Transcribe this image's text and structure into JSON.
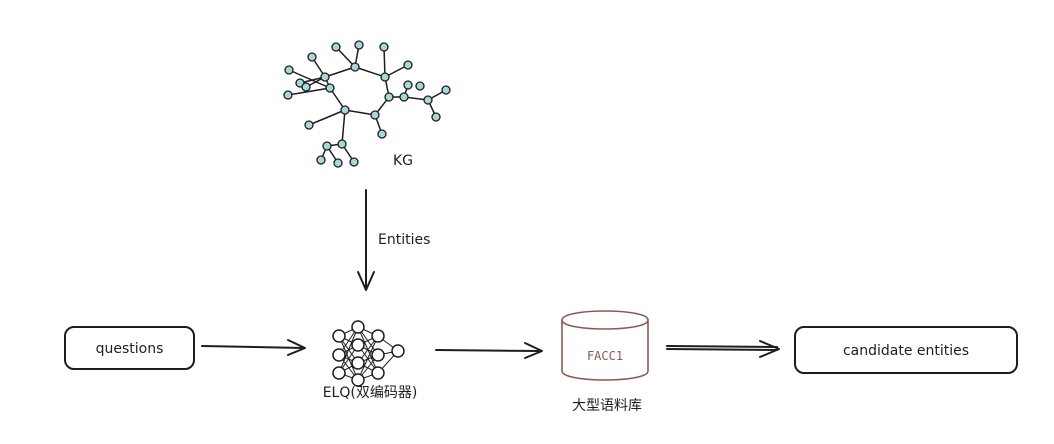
{
  "kg": {
    "label": "KG"
  },
  "edges": {
    "entities_label": "Entities"
  },
  "nodes": {
    "questions": "questions",
    "elq": "ELQ(双编码器)",
    "facc1": "FACC1",
    "corpus": "大型语料库",
    "candidates": "candidate entities"
  },
  "colors": {
    "kg_node_fill": "#a5d8d6",
    "stroke": "#1e1e1e",
    "database_stroke": "#8a5a4e"
  }
}
